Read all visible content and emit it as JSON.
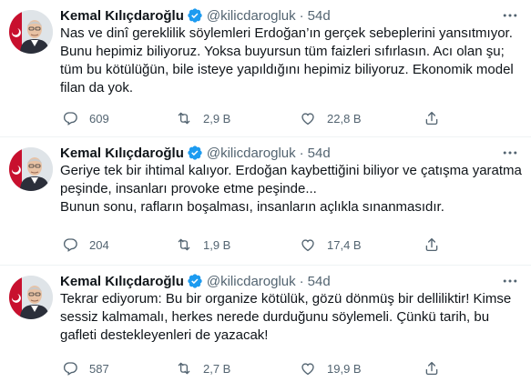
{
  "tweets": [
    {
      "author": "Kemal Kılıçdaroğlu",
      "handle": "@kilicdarogluk",
      "separator": "·",
      "time": "54d",
      "lines": [
        "Nas ve dinî gereklilik söylemleri Erdoğan’ın gerçek sebeplerini yansıtmıyor.",
        "Bunu hepimiz biliyoruz. Yoksa buyursun tüm faizleri sıfırlasın. Acı olan şu;",
        "tüm bu kötülüğün, bile isteye yapıldığını hepimiz biliyoruz. Ekonomik model",
        "filan da yok."
      ],
      "replies": "609",
      "retweets": "2,9 B",
      "likes": "22,8 B"
    },
    {
      "author": "Kemal Kılıçdaroğlu",
      "handle": "@kilicdarogluk",
      "separator": "·",
      "time": "54d",
      "lines": [
        "Geriye tek bir ihtimal kalıyor. Erdoğan kaybettiğini biliyor ve çatışma yaratma",
        "peşinde, insanları provoke etme peşinde...",
        "Bunun sonu, rafların boşalması, insanların açlıkla sınanmasıdır."
      ],
      "replies": "204",
      "retweets": "1,9 B",
      "likes": "17,4 B"
    },
    {
      "author": "Kemal Kılıçdaroğlu",
      "handle": "@kilicdarogluk",
      "separator": "·",
      "time": "54d",
      "lines": [
        "Tekrar ediyorum: Bu bir organize kötülük, gözü dönmüş bir delliliktir! Kimse",
        "sessiz kalmamalı, herkes nerede durduğunu söylemeli. Çünkü tarih, bu",
        "gafleti destekleyenleri de yazacak!"
      ],
      "replies": "587",
      "retweets": "2,7 B",
      "likes": "19,9 B"
    }
  ],
  "colors": {
    "text": "#0f1419",
    "secondary": "#536471",
    "verified": "#1d9bf0",
    "divider": "#eff3f4"
  },
  "icons": {
    "reply": "reply-icon",
    "retweet": "retweet-icon",
    "like": "like-icon",
    "share": "share-icon",
    "more": "more-icon",
    "verified": "verified-badge-icon"
  }
}
